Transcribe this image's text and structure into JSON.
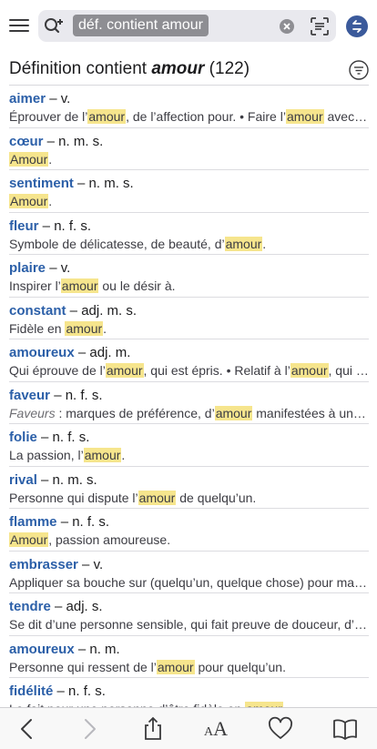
{
  "search": {
    "query": "déf. contient amour"
  },
  "header": {
    "prefix": "Définition contient ",
    "word": "amour",
    "count": " (122)"
  },
  "highlight": "amour",
  "entries": [
    {
      "term": "aimer",
      "gram": " – v.",
      "def": [
        {
          "t": "Éprouver de l’"
        },
        {
          "h": "amour"
        },
        {
          "t": ", de l’affection pour. • Faire l’"
        },
        {
          "h": "amour"
        },
        {
          "t": " avec quelqu’un."
        }
      ]
    },
    {
      "term": "cœur",
      "gram": " – n. m. s.",
      "def": [
        {
          "h": "Amour"
        },
        {
          "t": "."
        }
      ]
    },
    {
      "term": "sentiment",
      "gram": " – n. m. s.",
      "def": [
        {
          "h": "Amour"
        },
        {
          "t": "."
        }
      ]
    },
    {
      "term": "fleur",
      "gram": " – n. f. s.",
      "def": [
        {
          "t": "Symbole de délicatesse, de beauté, d’"
        },
        {
          "h": "amour"
        },
        {
          "t": "."
        }
      ]
    },
    {
      "term": "plaire",
      "gram": " – v.",
      "def": [
        {
          "t": "Inspirer l’"
        },
        {
          "h": "amour"
        },
        {
          "t": " ou le désir à."
        }
      ]
    },
    {
      "term": "constant",
      "gram": " – adj. m. s.",
      "def": [
        {
          "t": "Fidèle en "
        },
        {
          "h": "amour"
        },
        {
          "t": "."
        }
      ]
    },
    {
      "term": "amoureux",
      "gram": " – adj. m.",
      "def": [
        {
          "t": "Qui éprouve de l’"
        },
        {
          "h": "amour"
        },
        {
          "t": ", qui est épris. • Relatif à l’"
        },
        {
          "h": "amour"
        },
        {
          "t": ", qui exprime l’amour."
        }
      ]
    },
    {
      "term": "faveur",
      "gram": " – n. f. s.",
      "def": [
        {
          "i": "Faveurs"
        },
        {
          "t": " : marques de préférence, d’"
        },
        {
          "h": "amour"
        },
        {
          "t": " manifestées à une personne."
        }
      ]
    },
    {
      "term": "folie",
      "gram": " – n. f. s.",
      "def": [
        {
          "t": "La passion, l’"
        },
        {
          "h": "amour"
        },
        {
          "t": "."
        }
      ]
    },
    {
      "term": "rival",
      "gram": " – n. m. s.",
      "def": [
        {
          "t": "Personne qui dispute l’"
        },
        {
          "h": "amour"
        },
        {
          "t": " de quelqu’un."
        }
      ]
    },
    {
      "term": "flamme",
      "gram": " – n. f. s.",
      "def": [
        {
          "h": "Amour"
        },
        {
          "t": ", passion amoureuse."
        }
      ]
    },
    {
      "term": "embrasser",
      "gram": " – v.",
      "def": [
        {
          "t": "Appliquer sa bouche sur (quelqu’un, quelque chose) pour marquer son affection."
        }
      ]
    },
    {
      "term": "tendre",
      "gram": " – adj. s.",
      "def": [
        {
          "t": "Se dit d’une personne sensible, qui fait preuve de douceur, d’amour."
        }
      ]
    },
    {
      "term": "amoureux",
      "gram": " – n. m.",
      "def": [
        {
          "t": "Personne qui ressent de l’"
        },
        {
          "h": "amour"
        },
        {
          "t": " pour quelqu’un."
        }
      ]
    },
    {
      "term": "fidélité",
      "gram": " – n. f. s.",
      "def": [
        {
          "t": "Le fait pour une personne d’être fidèle en "
        },
        {
          "h": "amour"
        },
        {
          "t": "."
        }
      ]
    }
  ],
  "toolbar": {
    "text_size_label_large": "A",
    "text_size_label_small": "A"
  },
  "colors": {
    "term": "#2b5fa8",
    "highlight": "#f6e58d",
    "search_chip": "#8e8e93",
    "back_button": "#3b5a9b"
  }
}
